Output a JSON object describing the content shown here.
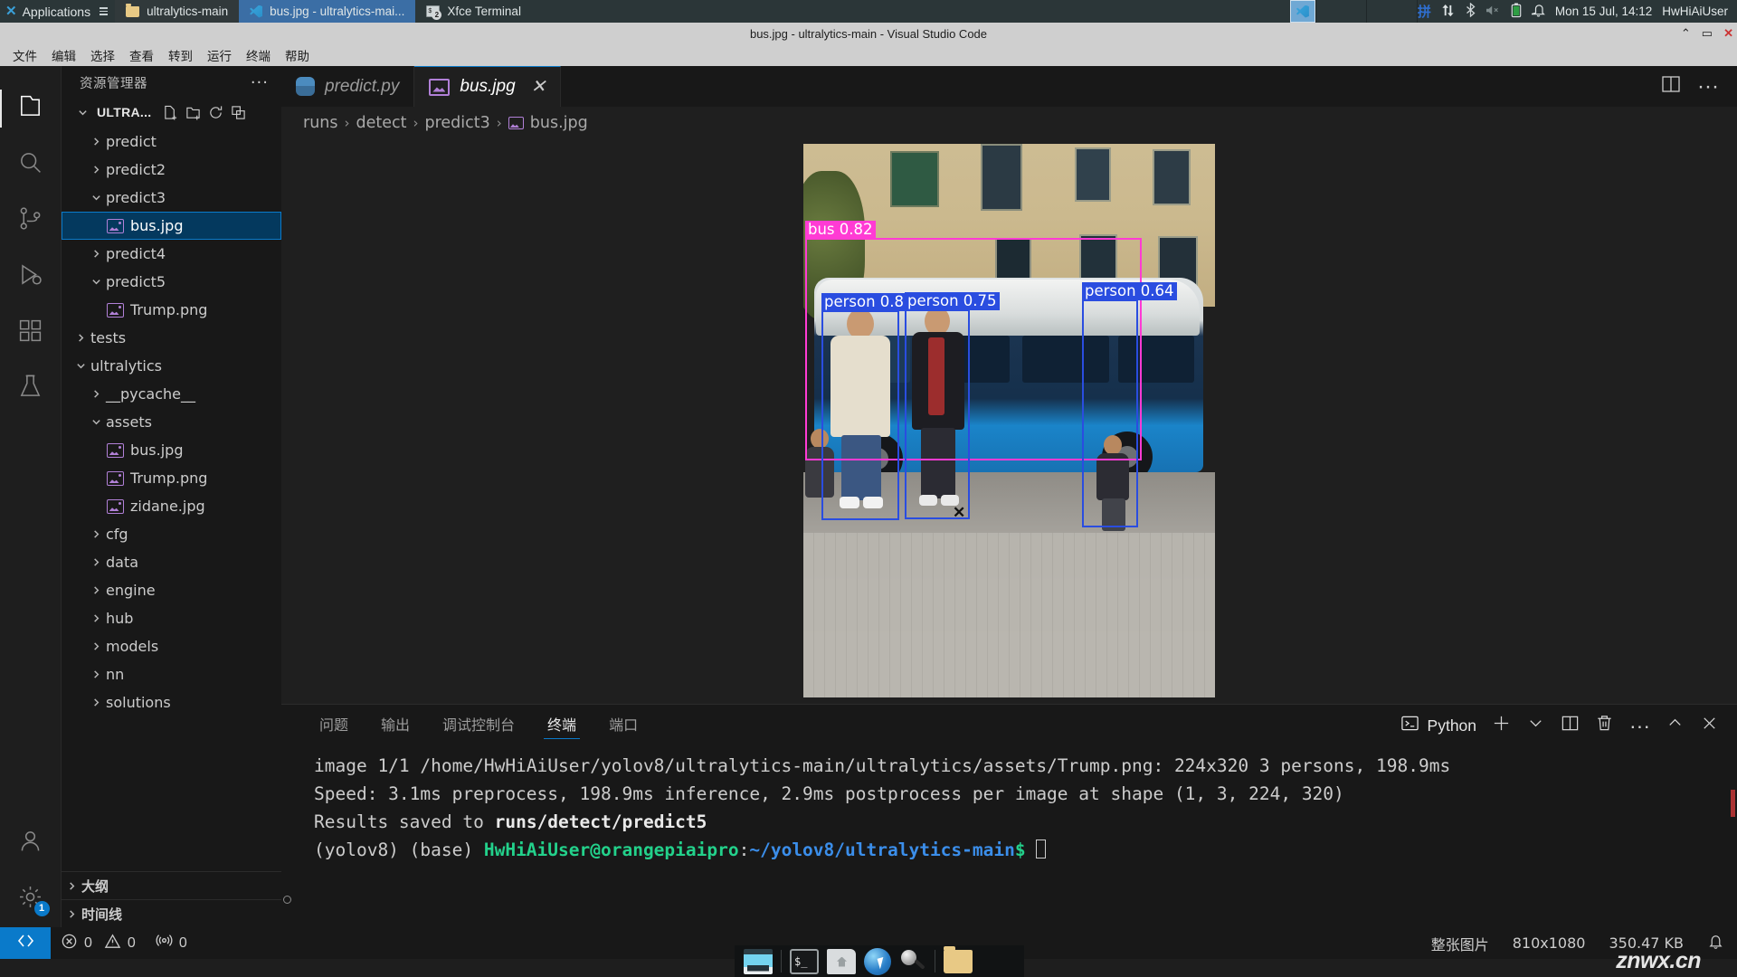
{
  "xfce": {
    "applications_label": "Applications",
    "tasks": [
      {
        "label": "ultralytics-main",
        "icon": "folder-icon",
        "state": "inactive"
      },
      {
        "label": "bus.jpg - ultralytics-mai...",
        "icon": "vscode-icon",
        "state": "active"
      },
      {
        "label": "Xfce Terminal",
        "icon": "terminal-icon",
        "state": "plain",
        "badge": "2"
      }
    ],
    "tray": {
      "input_method": "拼",
      "icons": [
        "network-icon",
        "bluetooth-icon",
        "volume-muted-icon",
        "battery-icon",
        "bell-icon"
      ],
      "datetime": "Mon 15 Jul, 14:12",
      "user": "HwHiAiUser"
    }
  },
  "window": {
    "title": "bus.jpg - ultralytics-main - Visual Studio Code",
    "buttons": {
      "minimize": "⌃",
      "maximize": "▭",
      "close": "✕"
    }
  },
  "menubar": [
    "文件",
    "编辑",
    "选择",
    "查看",
    "转到",
    "运行",
    "终端",
    "帮助"
  ],
  "activitybar": [
    {
      "name": "explorer",
      "icon": "files-icon",
      "active": true
    },
    {
      "name": "search",
      "icon": "search-icon",
      "active": false
    },
    {
      "name": "source-control",
      "icon": "source-control-icon",
      "active": false
    },
    {
      "name": "run-debug",
      "icon": "run-debug-icon",
      "active": false
    },
    {
      "name": "extensions",
      "icon": "extensions-icon",
      "active": false
    },
    {
      "name": "testing",
      "icon": "beaker-icon",
      "active": false
    },
    {
      "name": "accounts",
      "icon": "account-icon",
      "active": false
    },
    {
      "name": "settings",
      "icon": "gear-icon",
      "active": false,
      "badge": "1"
    }
  ],
  "sidebar": {
    "title": "资源管理器",
    "more_label": "···",
    "root": "ULTRA...",
    "root_actions": [
      "new-file-icon",
      "new-folder-icon",
      "refresh-icon",
      "collapse-all-icon"
    ],
    "tree": [
      {
        "label": "predict",
        "type": "folder",
        "state": "collapsed",
        "indent": 1
      },
      {
        "label": "predict2",
        "type": "folder",
        "state": "collapsed",
        "indent": 1
      },
      {
        "label": "predict3",
        "type": "folder",
        "state": "expanded",
        "indent": 1
      },
      {
        "label": "bus.jpg",
        "type": "image",
        "state": "selected",
        "indent": 2
      },
      {
        "label": "predict4",
        "type": "folder",
        "state": "collapsed",
        "indent": 1
      },
      {
        "label": "predict5",
        "type": "folder",
        "state": "expanded",
        "indent": 1
      },
      {
        "label": "Trump.png",
        "type": "image",
        "state": "none",
        "indent": 2
      },
      {
        "label": "tests",
        "type": "folder",
        "state": "collapsed",
        "indent": 0
      },
      {
        "label": "ultralytics",
        "type": "folder",
        "state": "expanded",
        "indent": 0
      },
      {
        "label": "__pycache__",
        "type": "folder",
        "state": "collapsed",
        "indent": 1
      },
      {
        "label": "assets",
        "type": "folder",
        "state": "expanded",
        "indent": 1
      },
      {
        "label": "bus.jpg",
        "type": "image",
        "state": "none",
        "indent": 2
      },
      {
        "label": "Trump.png",
        "type": "image",
        "state": "none",
        "indent": 2
      },
      {
        "label": "zidane.jpg",
        "type": "image",
        "state": "none",
        "indent": 2
      },
      {
        "label": "cfg",
        "type": "folder",
        "state": "collapsed",
        "indent": 1
      },
      {
        "label": "data",
        "type": "folder",
        "state": "collapsed",
        "indent": 1
      },
      {
        "label": "engine",
        "type": "folder",
        "state": "collapsed",
        "indent": 1
      },
      {
        "label": "hub",
        "type": "folder",
        "state": "collapsed",
        "indent": 1
      },
      {
        "label": "models",
        "type": "folder",
        "state": "collapsed",
        "indent": 1
      },
      {
        "label": "nn",
        "type": "folder",
        "state": "collapsed",
        "indent": 1
      },
      {
        "label": "solutions",
        "type": "folder",
        "state": "collapsed",
        "indent": 1
      }
    ],
    "sections": [
      "大纲",
      "时间线"
    ]
  },
  "editor": {
    "tabs": [
      {
        "label": "predict.py",
        "icon": "python-icon",
        "active": false
      },
      {
        "label": "bus.jpg",
        "icon": "image-icon",
        "active": true,
        "close": "✕"
      }
    ],
    "actions": [
      "split-editor-icon",
      "more-actions-icon"
    ],
    "breadcrumb": [
      "runs",
      "detect",
      "predict3",
      "bus.jpg"
    ],
    "breadcrumb_sep": "›"
  },
  "image_preview": {
    "detections": [
      {
        "label": "bus 0.82",
        "class": "bus",
        "confidence": 0.82
      },
      {
        "label": "person 0.85",
        "class": "person",
        "confidence": 0.85
      },
      {
        "label": "person 0.75",
        "class": "person",
        "confidence": 0.75
      },
      {
        "label": "person 0.64",
        "class": "person",
        "confidence": 0.64
      }
    ],
    "cursor": "✕"
  },
  "panel": {
    "tabs": [
      "问题",
      "输出",
      "调试控制台",
      "终端",
      "端口"
    ],
    "active_tab": "终端",
    "terminal_kind": "Python",
    "actions": [
      "new-terminal-icon",
      "dropdown-icon",
      "split-terminal-icon",
      "kill-terminal-icon",
      "more-icon",
      "maximize-panel-icon",
      "close-panel-icon"
    ],
    "terminal_lines": [
      "image 1/1 /home/HwHiAiUser/yolov8/ultralytics-main/ultralytics/assets/Trump.png: 224x320 3 persons, 198.9ms",
      "Speed: 3.1ms preprocess, 198.9ms inference, 2.9ms postprocess per image at shape (1, 3, 224, 320)",
      "Results saved to runs/detect/predict5"
    ],
    "results_prefix": "Results saved to ",
    "results_path": "runs/detect/predict5",
    "prompt_env": "(yolov8) (base) ",
    "prompt_user": "HwHiAiUser@orangepiaipro",
    "prompt_colon": ":",
    "prompt_path": "~/yolov8/ultralytics-main",
    "prompt_dollar": "$"
  },
  "statusbar": {
    "remote_icon": "remote-window-icon",
    "errors_icon": "error-icon",
    "errors": "0",
    "warnings_icon": "warning-icon",
    "warnings": "0",
    "ports_icon": "radio-tower-icon",
    "ports": "0",
    "image_mode": "整张图片",
    "dimensions": "810x1080",
    "filesize": "350.47 KB",
    "bell_icon": "bell-icon"
  },
  "dock": [
    "file-manager-icon",
    "terminal-icon",
    "home-folder-icon",
    "browser-icon",
    "magnifier-icon",
    "folder-icon"
  ],
  "watermark": "znwx.cn",
  "colors": {
    "accent": "#0a7aca",
    "bus_box": "#ff3bd4",
    "person_box": "#2a4de0",
    "panel_bg": "#181818",
    "editor_bg": "#1f1f1f"
  }
}
